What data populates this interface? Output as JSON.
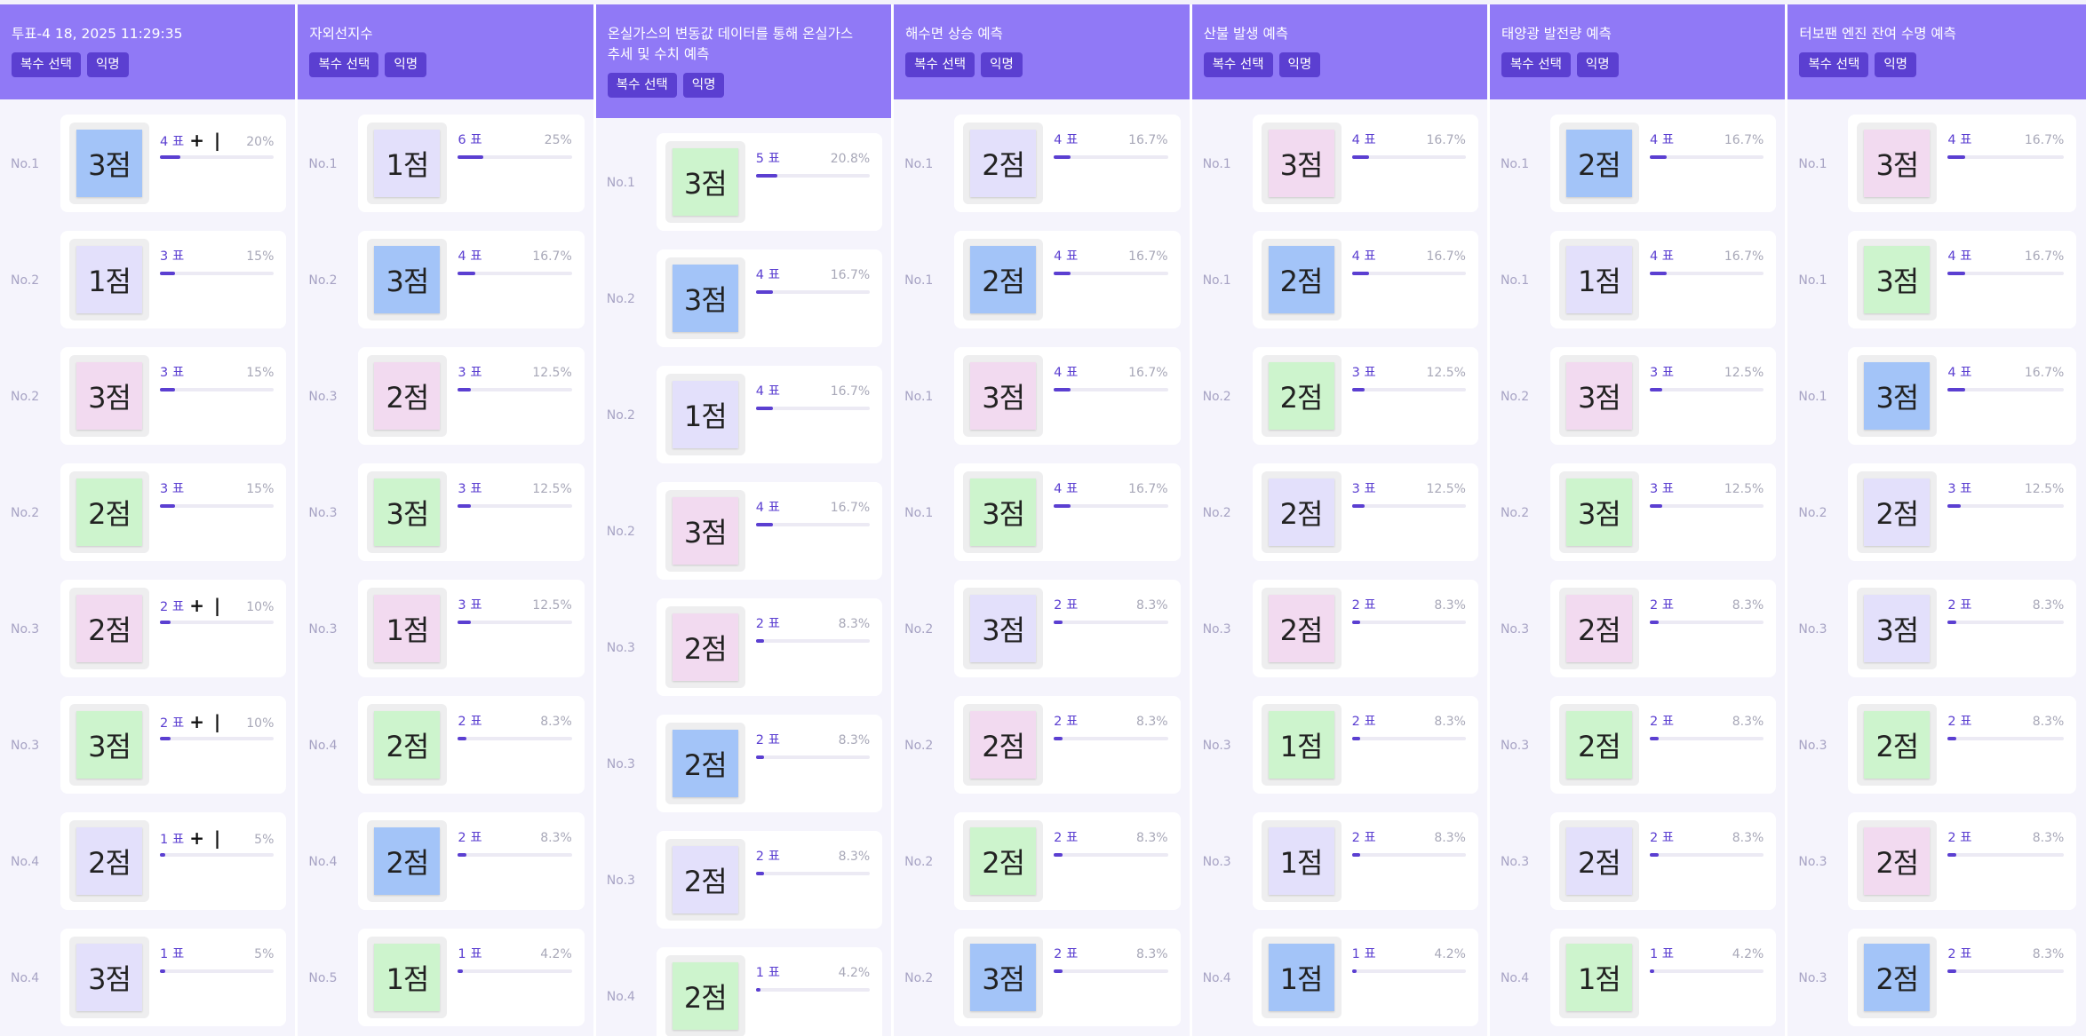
{
  "columns": [
    {
      "title": "투표-4 18, 2025 11:29:35",
      "badges": [
        "복수 선택",
        "익명"
      ],
      "items": [
        {
          "rank": "No.1",
          "note": "3점",
          "color": "blue",
          "votes": "4 표",
          "mark": "+ |",
          "pct": "20%",
          "fill": 20
        },
        {
          "rank": "No.2",
          "note": "1점",
          "color": "lavender",
          "votes": "3 표",
          "mark": "",
          "pct": "15%",
          "fill": 15
        },
        {
          "rank": "No.2",
          "note": "3점",
          "color": "pink",
          "votes": "3 표",
          "mark": "",
          "pct": "15%",
          "fill": 15
        },
        {
          "rank": "No.2",
          "note": "2점",
          "color": "green",
          "votes": "3 표",
          "mark": "",
          "pct": "15%",
          "fill": 15
        },
        {
          "rank": "No.3",
          "note": "2점",
          "color": "pink",
          "votes": "2 표",
          "mark": "+ |",
          "pct": "10%",
          "fill": 10
        },
        {
          "rank": "No.3",
          "note": "3점",
          "color": "green",
          "votes": "2 표",
          "mark": "+ |",
          "pct": "10%",
          "fill": 10
        },
        {
          "rank": "No.4",
          "note": "2점",
          "color": "lavender",
          "votes": "1 표",
          "mark": "+ |",
          "pct": "5%",
          "fill": 5
        },
        {
          "rank": "No.4",
          "note": "3점",
          "color": "lavender",
          "votes": "1 표",
          "mark": "",
          "pct": "5%",
          "fill": 5
        }
      ]
    },
    {
      "title": "자외선지수",
      "badges": [
        "복수 선택",
        "익명"
      ],
      "items": [
        {
          "rank": "No.1",
          "note": "1점",
          "color": "lavender",
          "votes": "6 표",
          "mark": "",
          "pct": "25%",
          "fill": 25
        },
        {
          "rank": "No.2",
          "note": "3점",
          "color": "blue",
          "votes": "4 표",
          "mark": "",
          "pct": "16.7%",
          "fill": 16.7
        },
        {
          "rank": "No.3",
          "note": "2점",
          "color": "pink",
          "votes": "3 표",
          "mark": "",
          "pct": "12.5%",
          "fill": 12.5
        },
        {
          "rank": "No.3",
          "note": "3점",
          "color": "green",
          "votes": "3 표",
          "mark": "",
          "pct": "12.5%",
          "fill": 12.5
        },
        {
          "rank": "No.3",
          "note": "1점",
          "color": "pink",
          "votes": "3 표",
          "mark": "",
          "pct": "12.5%",
          "fill": 12.5
        },
        {
          "rank": "No.4",
          "note": "2점",
          "color": "green",
          "votes": "2 표",
          "mark": "",
          "pct": "8.3%",
          "fill": 8.3
        },
        {
          "rank": "No.4",
          "note": "2점",
          "color": "blue",
          "votes": "2 표",
          "mark": "",
          "pct": "8.3%",
          "fill": 8.3
        },
        {
          "rank": "No.5",
          "note": "1점",
          "color": "green",
          "votes": "1 표",
          "mark": "",
          "pct": "4.2%",
          "fill": 4.2
        }
      ]
    },
    {
      "title": "온실가스의 변동값 데이터를 통해 온실가스 추세 및 수치 예측",
      "tall": true,
      "badges": [
        "복수 선택",
        "익명"
      ],
      "items": [
        {
          "rank": "No.1",
          "note": "3점",
          "color": "green",
          "votes": "5 표",
          "mark": "",
          "pct": "20.8%",
          "fill": 20.8
        },
        {
          "rank": "No.2",
          "note": "3점",
          "color": "blue",
          "votes": "4 표",
          "mark": "",
          "pct": "16.7%",
          "fill": 16.7
        },
        {
          "rank": "No.2",
          "note": "1점",
          "color": "lavender",
          "votes": "4 표",
          "mark": "",
          "pct": "16.7%",
          "fill": 16.7
        },
        {
          "rank": "No.2",
          "note": "3점",
          "color": "pink",
          "votes": "4 표",
          "mark": "",
          "pct": "16.7%",
          "fill": 16.7
        },
        {
          "rank": "No.3",
          "note": "2점",
          "color": "pink",
          "votes": "2 표",
          "mark": "",
          "pct": "8.3%",
          "fill": 8.3
        },
        {
          "rank": "No.3",
          "note": "2점",
          "color": "blue",
          "votes": "2 표",
          "mark": "",
          "pct": "8.3%",
          "fill": 8.3
        },
        {
          "rank": "No.3",
          "note": "2점",
          "color": "lavender",
          "votes": "2 표",
          "mark": "",
          "pct": "8.3%",
          "fill": 8.3
        },
        {
          "rank": "No.4",
          "note": "2점",
          "color": "green",
          "votes": "1 표",
          "mark": "",
          "pct": "4.2%",
          "fill": 4.2
        }
      ]
    },
    {
      "title": "해수면 상승 예측",
      "badges": [
        "복수 선택",
        "익명"
      ],
      "items": [
        {
          "rank": "No.1",
          "note": "2점",
          "color": "lavender",
          "votes": "4 표",
          "mark": "",
          "pct": "16.7%",
          "fill": 16.7
        },
        {
          "rank": "No.1",
          "note": "2점",
          "color": "blue",
          "votes": "4 표",
          "mark": "",
          "pct": "16.7%",
          "fill": 16.7
        },
        {
          "rank": "No.1",
          "note": "3점",
          "color": "pink",
          "votes": "4 표",
          "mark": "",
          "pct": "16.7%",
          "fill": 16.7
        },
        {
          "rank": "No.1",
          "note": "3점",
          "color": "green",
          "votes": "4 표",
          "mark": "",
          "pct": "16.7%",
          "fill": 16.7
        },
        {
          "rank": "No.2",
          "note": "3점",
          "color": "lavender",
          "votes": "2 표",
          "mark": "",
          "pct": "8.3%",
          "fill": 8.3
        },
        {
          "rank": "No.2",
          "note": "2점",
          "color": "pink",
          "votes": "2 표",
          "mark": "",
          "pct": "8.3%",
          "fill": 8.3
        },
        {
          "rank": "No.2",
          "note": "2점",
          "color": "green",
          "votes": "2 표",
          "mark": "",
          "pct": "8.3%",
          "fill": 8.3
        },
        {
          "rank": "No.2",
          "note": "3점",
          "color": "blue",
          "votes": "2 표",
          "mark": "",
          "pct": "8.3%",
          "fill": 8.3
        }
      ]
    },
    {
      "title": "산불 발생 예측",
      "badges": [
        "복수 선택",
        "익명"
      ],
      "items": [
        {
          "rank": "No.1",
          "note": "3점",
          "color": "pink",
          "votes": "4 표",
          "mark": "",
          "pct": "16.7%",
          "fill": 16.7
        },
        {
          "rank": "No.1",
          "note": "2점",
          "color": "blue",
          "votes": "4 표",
          "mark": "",
          "pct": "16.7%",
          "fill": 16.7
        },
        {
          "rank": "No.2",
          "note": "2점",
          "color": "green",
          "votes": "3 표",
          "mark": "",
          "pct": "12.5%",
          "fill": 12.5
        },
        {
          "rank": "No.2",
          "note": "2점",
          "color": "lavender",
          "votes": "3 표",
          "mark": "",
          "pct": "12.5%",
          "fill": 12.5
        },
        {
          "rank": "No.3",
          "note": "2점",
          "color": "pink",
          "votes": "2 표",
          "mark": "",
          "pct": "8.3%",
          "fill": 8.3
        },
        {
          "rank": "No.3",
          "note": "1점",
          "color": "green",
          "votes": "2 표",
          "mark": "",
          "pct": "8.3%",
          "fill": 8.3
        },
        {
          "rank": "No.3",
          "note": "1점",
          "color": "lavender",
          "votes": "2 표",
          "mark": "",
          "pct": "8.3%",
          "fill": 8.3
        },
        {
          "rank": "No.4",
          "note": "1점",
          "color": "blue",
          "votes": "1 표",
          "mark": "",
          "pct": "4.2%",
          "fill": 4.2
        }
      ]
    },
    {
      "title": "태양광 발전량 예측",
      "badges": [
        "복수 선택",
        "익명"
      ],
      "items": [
        {
          "rank": "No.1",
          "note": "2점",
          "color": "blue",
          "votes": "4 표",
          "mark": "",
          "pct": "16.7%",
          "fill": 16.7
        },
        {
          "rank": "No.1",
          "note": "1점",
          "color": "lavender",
          "votes": "4 표",
          "mark": "",
          "pct": "16.7%",
          "fill": 16.7
        },
        {
          "rank": "No.2",
          "note": "3점",
          "color": "pink",
          "votes": "3 표",
          "mark": "",
          "pct": "12.5%",
          "fill": 12.5
        },
        {
          "rank": "No.2",
          "note": "3점",
          "color": "green",
          "votes": "3 표",
          "mark": "",
          "pct": "12.5%",
          "fill": 12.5
        },
        {
          "rank": "No.3",
          "note": "2점",
          "color": "pink",
          "votes": "2 표",
          "mark": "",
          "pct": "8.3%",
          "fill": 8.3
        },
        {
          "rank": "No.3",
          "note": "2점",
          "color": "green",
          "votes": "2 표",
          "mark": "",
          "pct": "8.3%",
          "fill": 8.3
        },
        {
          "rank": "No.3",
          "note": "2점",
          "color": "lavender",
          "votes": "2 표",
          "mark": "",
          "pct": "8.3%",
          "fill": 8.3
        },
        {
          "rank": "No.4",
          "note": "1점",
          "color": "green",
          "votes": "1 표",
          "mark": "",
          "pct": "4.2%",
          "fill": 4.2
        }
      ]
    },
    {
      "title": "터보팬 엔진 잔여 수명 예측",
      "badges": [
        "복수 선택",
        "익명"
      ],
      "items": [
        {
          "rank": "No.1",
          "note": "3점",
          "color": "pink",
          "votes": "4 표",
          "mark": "",
          "pct": "16.7%",
          "fill": 16.7
        },
        {
          "rank": "No.1",
          "note": "3점",
          "color": "green",
          "votes": "4 표",
          "mark": "",
          "pct": "16.7%",
          "fill": 16.7
        },
        {
          "rank": "No.1",
          "note": "3점",
          "color": "blue",
          "votes": "4 표",
          "mark": "",
          "pct": "16.7%",
          "fill": 16.7
        },
        {
          "rank": "No.2",
          "note": "2점",
          "color": "lavender",
          "votes": "3 표",
          "mark": "",
          "pct": "12.5%",
          "fill": 12.5
        },
        {
          "rank": "No.3",
          "note": "3점",
          "color": "lavender",
          "votes": "2 표",
          "mark": "",
          "pct": "8.3%",
          "fill": 8.3
        },
        {
          "rank": "No.3",
          "note": "2점",
          "color": "green",
          "votes": "2 표",
          "mark": "",
          "pct": "8.3%",
          "fill": 8.3
        },
        {
          "rank": "No.3",
          "note": "2점",
          "color": "pink",
          "votes": "2 표",
          "mark": "",
          "pct": "8.3%",
          "fill": 8.3
        },
        {
          "rank": "No.3",
          "note": "2점",
          "color": "blue",
          "votes": "2 표",
          "mark": "",
          "pct": "8.3%",
          "fill": 8.3
        }
      ]
    }
  ],
  "colors": {
    "header": "#9079f6",
    "badge": "#5b3fd1",
    "accent": "#5b3fd1",
    "note_blue": "#a3c4f8",
    "note_lavender": "#e3e0fb",
    "note_pink": "#f2daf0",
    "note_green": "#cdf4cd"
  }
}
